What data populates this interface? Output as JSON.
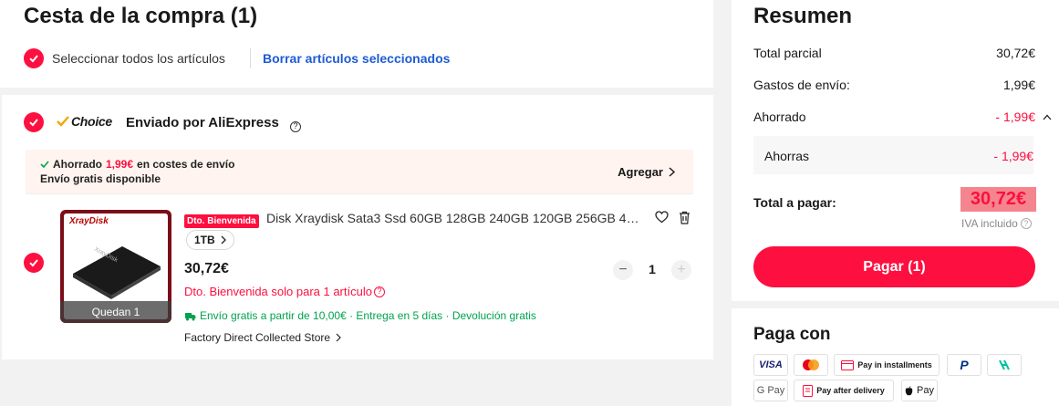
{
  "cart": {
    "title": "Cesta de la compra (1)",
    "select_all": "Seleccionar todos los artículos",
    "delete_selected": "Borrar artículos seleccionados"
  },
  "store": {
    "choice_label": "Choice",
    "shipped_by": "Enviado por AliExpress",
    "saved_prefix": "Ahorrado",
    "saved_amount": "1,99€",
    "saved_suffix": "en costes de envío",
    "free_shipping": "Envío gratis disponible",
    "add_label": "Agregar"
  },
  "item": {
    "thumb_brand": "XrayDisk",
    "thumb_product_text": "XrayDisk",
    "thumb_left": "Quedan 1",
    "badge": "Dto. Bienvenida",
    "title": "Disk Xraydisk Sata3 Ssd 60GB 128GB 240GB 120GB 256GB 48...",
    "variant": "1TB",
    "price": "30,72€",
    "quantity": "1",
    "promo": "Dto. Bienvenida solo para 1 artículo",
    "shipping_info": "Envío gratis a partir de 10,00€ · Entrega en 5 días · Devolución gratis",
    "store_name": "Factory Direct Collected Store"
  },
  "summary": {
    "title": "Resumen",
    "subtotal_label": "Total parcial",
    "subtotal_value": "30,72€",
    "shipping_label": "Gastos de envío:",
    "shipping_value": "1,99€",
    "saved_label": "Ahorrado",
    "saved_value": "- 1,99€",
    "savings_label": "Ahorras",
    "savings_value": "- 1,99€",
    "total_label": "Total a pagar:",
    "total_value": "30,72€",
    "vat_note": "IVA incluido",
    "pay_button": "Pagar (1)"
  },
  "pay_with": {
    "title": "Paga con",
    "visa": "VISA",
    "installments": "Pay in installments",
    "gpay": "G Pay",
    "after_delivery": "Pay after delivery",
    "applepay": "Pay"
  },
  "colors": {
    "accent": "#fd0f3f",
    "link": "#1d5bd5",
    "green": "#00a34d"
  }
}
